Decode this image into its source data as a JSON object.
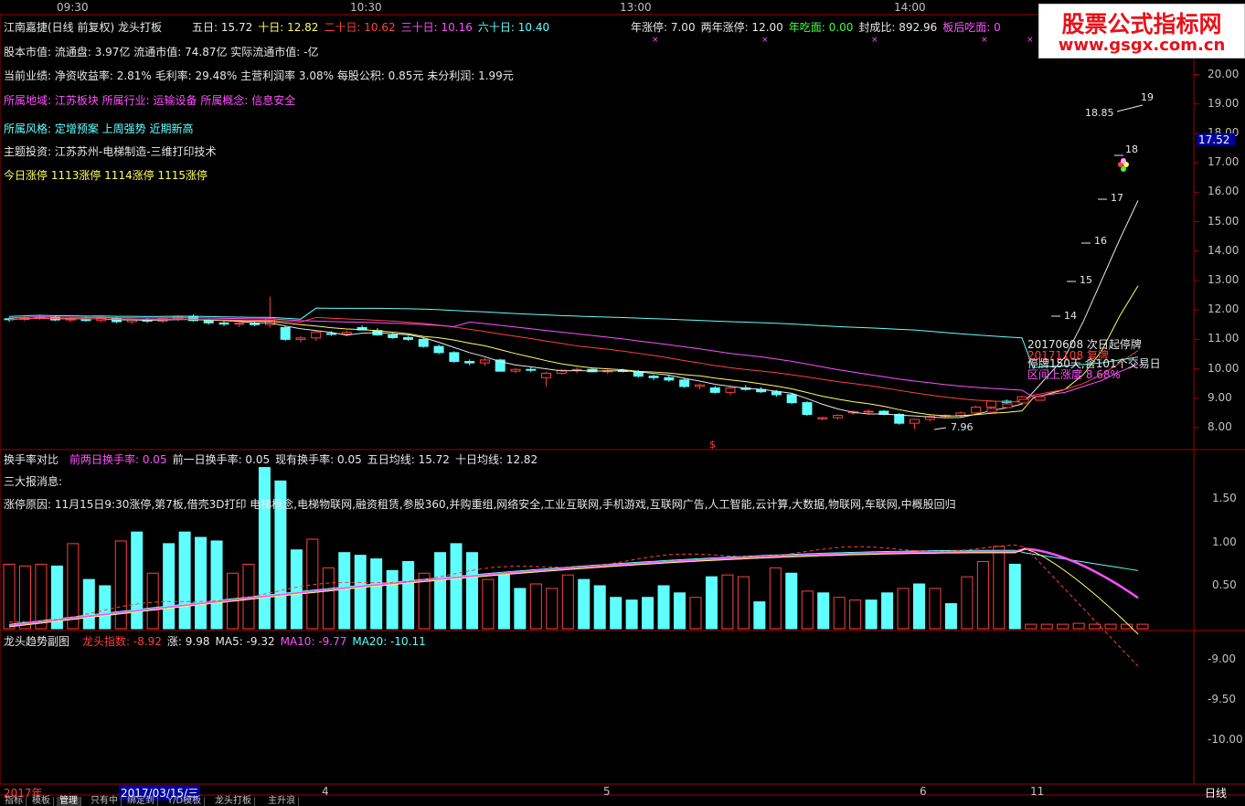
{
  "header": {
    "time_ticks": [
      "09:30",
      "10:30",
      "13:00",
      "14:00"
    ],
    "title": "江南嘉捷(日线 前复权) 龙头打板",
    "ma_items": [
      {
        "label": "五日: 15.72",
        "color": "#e8e8e8"
      },
      {
        "label": "十日: 12.82",
        "color": "#ffff60"
      },
      {
        "label": "二十日: 10.62",
        "color": "#ff4040"
      },
      {
        "label": "三十日: 10.16",
        "color": "#ff50ff"
      },
      {
        "label": "六十日: 10.40",
        "color": "#60ffff"
      }
    ],
    "right_items": [
      {
        "label": "年涨停: 7.00",
        "color": "#e8e8e8"
      },
      {
        "label": "两年涨停: 12.00",
        "color": "#e8e8e8"
      },
      {
        "label": "年吃面: 0.00",
        "color": "#40ff40"
      },
      {
        "label": "封成比: 892.96",
        "color": "#e8e8e8"
      },
      {
        "label": "板后吃面: 0",
        "color": "#ff50ff"
      }
    ]
  },
  "info": {
    "line1": "股本市值:  流通盘: 3.97亿 流通市值: 74.87亿  实际流通市值: -亿",
    "line2": "当前业绩:  净资收益率: 2.81% 毛利率: 29.48% 主营利润率 3.08% 每股公积: 0.85元 未分利润: 1.99元",
    "line3": "所属地域: 江苏板块  所属行业: 运输设备  所属概念: 信息安全",
    "line4": "所属风格: 定增预案 上周强势 近期新高",
    "line5": "主题投资:   江苏苏州-电梯制造-三维打印技术",
    "line6": "今日涨停 1113涨停 1114涨停 1115涨停"
  },
  "annotations": {
    "a1": "20170608 次日起停牌",
    "a2": "20171108 复牌",
    "a3": "停牌150天,含101个交易日",
    "a4": "区间上涨度 8.68%",
    "low_label": "7.96",
    "high_label": "18.85",
    "high_value": "19",
    "s_marker": "$",
    "step_labels": [
      "14",
      "15",
      "16",
      "17",
      "18"
    ]
  },
  "price_axis": {
    "ticks": [
      "20.00",
      "19.00",
      "18.00",
      "17.00",
      "16.00",
      "15.00",
      "14.00",
      "13.00",
      "12.00",
      "11.00",
      "10.00",
      "9.00",
      "8.00"
    ],
    "current": "17.52"
  },
  "turnover": {
    "title": "换手率对比",
    "items": [
      {
        "label": "前两日换手率: 0.05",
        "color": "#ff50ff"
      },
      {
        "label": "前一日换手率: 0.05",
        "color": "#e8e8e8"
      },
      {
        "label": "现有换手率: 0.05",
        "color": "#e8e8e8"
      },
      {
        "label": "五日均线: 15.72",
        "color": "#e8e8e8"
      },
      {
        "label": "十日均线: 12.82",
        "color": "#e8e8e8"
      }
    ],
    "line2": "三大报消息:",
    "line3": "涨停原因: 11月15日9:30涨停,第7板,借壳3D打印 电梯概念,电梯物联网,融资租赁,参股360,并购重组,网络安全,工业互联网,手机游戏,互联网广告,人工智能,云计算,大数据,物联网,车联网,中概股回归",
    "axis": [
      "1.50",
      "1.00",
      "0.50"
    ]
  },
  "trend": {
    "title": "龙头趋势副图",
    "items": [
      {
        "label": "龙头指数: -8.92",
        "color": "#ff4040"
      },
      {
        "label": "涨: 9.98",
        "color": "#e8e8e8"
      },
      {
        "label": "MA5: -9.32",
        "color": "#e8e8e8"
      },
      {
        "label": "MA10: -9.77",
        "color": "#ff50ff"
      },
      {
        "label": "MA20: -10.11",
        "color": "#60ffff"
      }
    ],
    "axis": [
      "-9.00",
      "-9.50",
      "-10.00"
    ]
  },
  "date_axis": {
    "labels": [
      "2017年",
      "2017/03/15/三",
      "4",
      "5",
      "6",
      "11"
    ],
    "period": "日线"
  },
  "bottom_tabs": [
    "指标",
    "模板",
    "管理",
    "只有中",
    "绑定到",
    "Y/D模板",
    "龙头打板",
    "主升浪"
  ],
  "watermark": {
    "line1": "股票公式指标网",
    "line2": "www.gsgx.com.cn"
  },
  "chart_data": [
    {
      "type": "candlestick",
      "title": "江南嘉捷(日线 前复权) 龙头打板",
      "ylim": [
        7.6,
        20.5
      ],
      "ohlc": [
        [
          11.7,
          11.75,
          11.6,
          11.68
        ],
        [
          11.68,
          11.78,
          11.62,
          11.72
        ],
        [
          11.72,
          11.8,
          11.65,
          11.76
        ],
        [
          11.76,
          11.82,
          11.62,
          11.66
        ],
        [
          11.66,
          11.74,
          11.58,
          11.7
        ],
        [
          11.7,
          11.78,
          11.6,
          11.64
        ],
        [
          11.64,
          11.76,
          11.58,
          11.72
        ],
        [
          11.72,
          11.76,
          11.55,
          11.6
        ],
        [
          11.6,
          11.7,
          11.52,
          11.66
        ],
        [
          11.66,
          11.74,
          11.56,
          11.62
        ],
        [
          11.62,
          11.72,
          11.55,
          11.7
        ],
        [
          11.7,
          11.82,
          11.62,
          11.78
        ],
        [
          11.78,
          11.85,
          11.6,
          11.64
        ],
        [
          11.64,
          11.7,
          11.5,
          11.56
        ],
        [
          11.56,
          11.62,
          11.45,
          11.52
        ],
        [
          11.52,
          11.58,
          11.42,
          11.55
        ],
        [
          11.55,
          11.62,
          11.45,
          11.5
        ],
        [
          11.5,
          12.45,
          11.4,
          11.7
        ],
        [
          11.4,
          11.45,
          10.95,
          11.0
        ],
        [
          11.0,
          11.1,
          10.9,
          11.05
        ],
        [
          11.05,
          11.3,
          10.95,
          11.25
        ],
        [
          11.2,
          11.28,
          11.12,
          11.18
        ],
        [
          11.18,
          11.3,
          11.1,
          11.24
        ],
        [
          11.4,
          11.48,
          11.3,
          11.32
        ],
        [
          11.3,
          11.38,
          11.12,
          11.15
        ],
        [
          11.15,
          11.22,
          11.02,
          11.06
        ],
        [
          11.06,
          11.12,
          10.95,
          11.0
        ],
        [
          11.0,
          11.05,
          10.72,
          10.76
        ],
        [
          10.76,
          10.82,
          10.5,
          10.55
        ],
        [
          10.55,
          10.6,
          10.2,
          10.25
        ],
        [
          10.25,
          10.32,
          10.12,
          10.2
        ],
        [
          10.2,
          10.38,
          10.1,
          10.3
        ],
        [
          10.3,
          10.34,
          9.9,
          9.92
        ],
        [
          9.92,
          10.02,
          9.85,
          9.98
        ],
        [
          9.98,
          10.05,
          9.88,
          9.95
        ],
        [
          9.7,
          9.9,
          9.4,
          9.85
        ],
        [
          9.85,
          10.0,
          9.8,
          9.95
        ],
        [
          9.95,
          10.05,
          9.85,
          9.98
        ],
        [
          9.98,
          10.02,
          9.88,
          9.9
        ],
        [
          9.9,
          9.98,
          9.82,
          9.94
        ],
        [
          9.94,
          10.0,
          9.88,
          9.92
        ],
        [
          9.88,
          9.96,
          9.7,
          9.75
        ],
        [
          9.75,
          9.8,
          9.62,
          9.7
        ],
        [
          9.7,
          9.8,
          9.55,
          9.62
        ],
        [
          9.62,
          9.7,
          9.35,
          9.4
        ],
        [
          9.4,
          9.5,
          9.3,
          9.45
        ],
        [
          9.35,
          9.42,
          9.15,
          9.2
        ],
        [
          9.2,
          9.4,
          9.1,
          9.35
        ],
        [
          9.35,
          9.45,
          9.25,
          9.3
        ],
        [
          9.3,
          9.38,
          9.18,
          9.22
        ],
        [
          9.22,
          9.28,
          9.05,
          9.12
        ],
        [
          9.12,
          9.18,
          8.8,
          8.85
        ],
        [
          8.85,
          8.9,
          8.4,
          8.45
        ],
        [
          8.3,
          8.38,
          8.25,
          8.34
        ],
        [
          8.34,
          8.45,
          8.28,
          8.42
        ],
        [
          8.5,
          8.58,
          8.44,
          8.55
        ],
        [
          8.55,
          8.62,
          8.48,
          8.56
        ],
        [
          8.56,
          8.6,
          8.42,
          8.45
        ],
        [
          8.45,
          8.5,
          8.1,
          8.15
        ],
        [
          8.15,
          8.3,
          7.96,
          8.28
        ],
        [
          8.28,
          8.42,
          8.22,
          8.38
        ],
        [
          8.4,
          8.46,
          8.34,
          8.42
        ],
        [
          8.42,
          8.55,
          8.36,
          8.5
        ],
        [
          8.5,
          8.75,
          8.46,
          8.7
        ],
        [
          8.7,
          8.92,
          8.65,
          8.9
        ],
        [
          8.9,
          8.96,
          8.82,
          8.86
        ],
        [
          8.9,
          9.1,
          8.86,
          9.05
        ]
      ],
      "post_resumption_steps": [
        14,
        15,
        16,
        17,
        18,
        19
      ],
      "ma_series": [
        {
          "name": "五日",
          "last": 15.72
        },
        {
          "name": "十日",
          "last": 12.82
        },
        {
          "name": "二十日",
          "last": 10.62
        },
        {
          "name": "三十日",
          "last": 10.16
        },
        {
          "name": "六十日",
          "last": 10.4
        }
      ]
    },
    {
      "type": "bar",
      "title": "换手率对比",
      "ylim": [
        0,
        1.9
      ],
      "values": [
        0.72,
        0.7,
        0.72,
        0.7,
        0.95,
        0.55,
        0.48,
        0.98,
        1.08,
        0.62,
        0.95,
        1.08,
        1.02,
        0.98,
        0.62,
        0.72,
        1.8,
        1.65,
        0.88,
        1.0,
        0.68,
        0.85,
        0.82,
        0.78,
        0.65,
        0.75,
        0.62,
        0.85,
        0.95,
        0.85,
        0.55,
        0.6,
        0.45,
        0.5,
        0.45,
        0.6,
        0.55,
        0.48,
        0.35,
        0.32,
        0.35,
        0.48,
        0.4,
        0.35,
        0.58,
        0.6,
        0.58,
        0.3,
        0.68,
        0.62,
        0.42,
        0.4,
        0.35,
        0.32,
        0.32,
        0.4,
        0.45,
        0.5,
        0.45,
        0.28,
        0.58,
        0.75,
        0.92,
        0.72,
        0.05,
        0.05,
        0.05,
        0.06,
        0.05,
        0.05,
        0.05,
        0.05
      ],
      "up_flags": [
        0,
        0,
        0,
        1,
        0,
        1,
        1,
        0,
        1,
        0,
        1,
        1,
        1,
        1,
        0,
        0,
        1,
        1,
        1,
        0,
        0,
        1,
        1,
        1,
        1,
        1,
        0,
        1,
        1,
        1,
        0,
        1,
        1,
        0,
        0,
        0,
        1,
        1,
        1,
        1,
        1,
        1,
        1,
        0,
        1,
        0,
        0,
        1,
        0,
        1,
        0,
        1,
        0,
        0,
        1,
        1,
        0,
        1,
        0,
        1,
        0,
        0,
        0,
        1,
        0,
        0,
        0,
        0,
        0,
        0,
        0,
        0
      ]
    },
    {
      "type": "line",
      "title": "龙头趋势副图",
      "ylim": [
        -10.45,
        -8.75
      ],
      "series": [
        {
          "name": "龙头指数",
          "last": -8.92
        },
        {
          "name": "MA5",
          "last": -9.32
        },
        {
          "name": "MA10",
          "last": -9.77
        },
        {
          "name": "MA20",
          "last": -10.11
        }
      ]
    }
  ]
}
